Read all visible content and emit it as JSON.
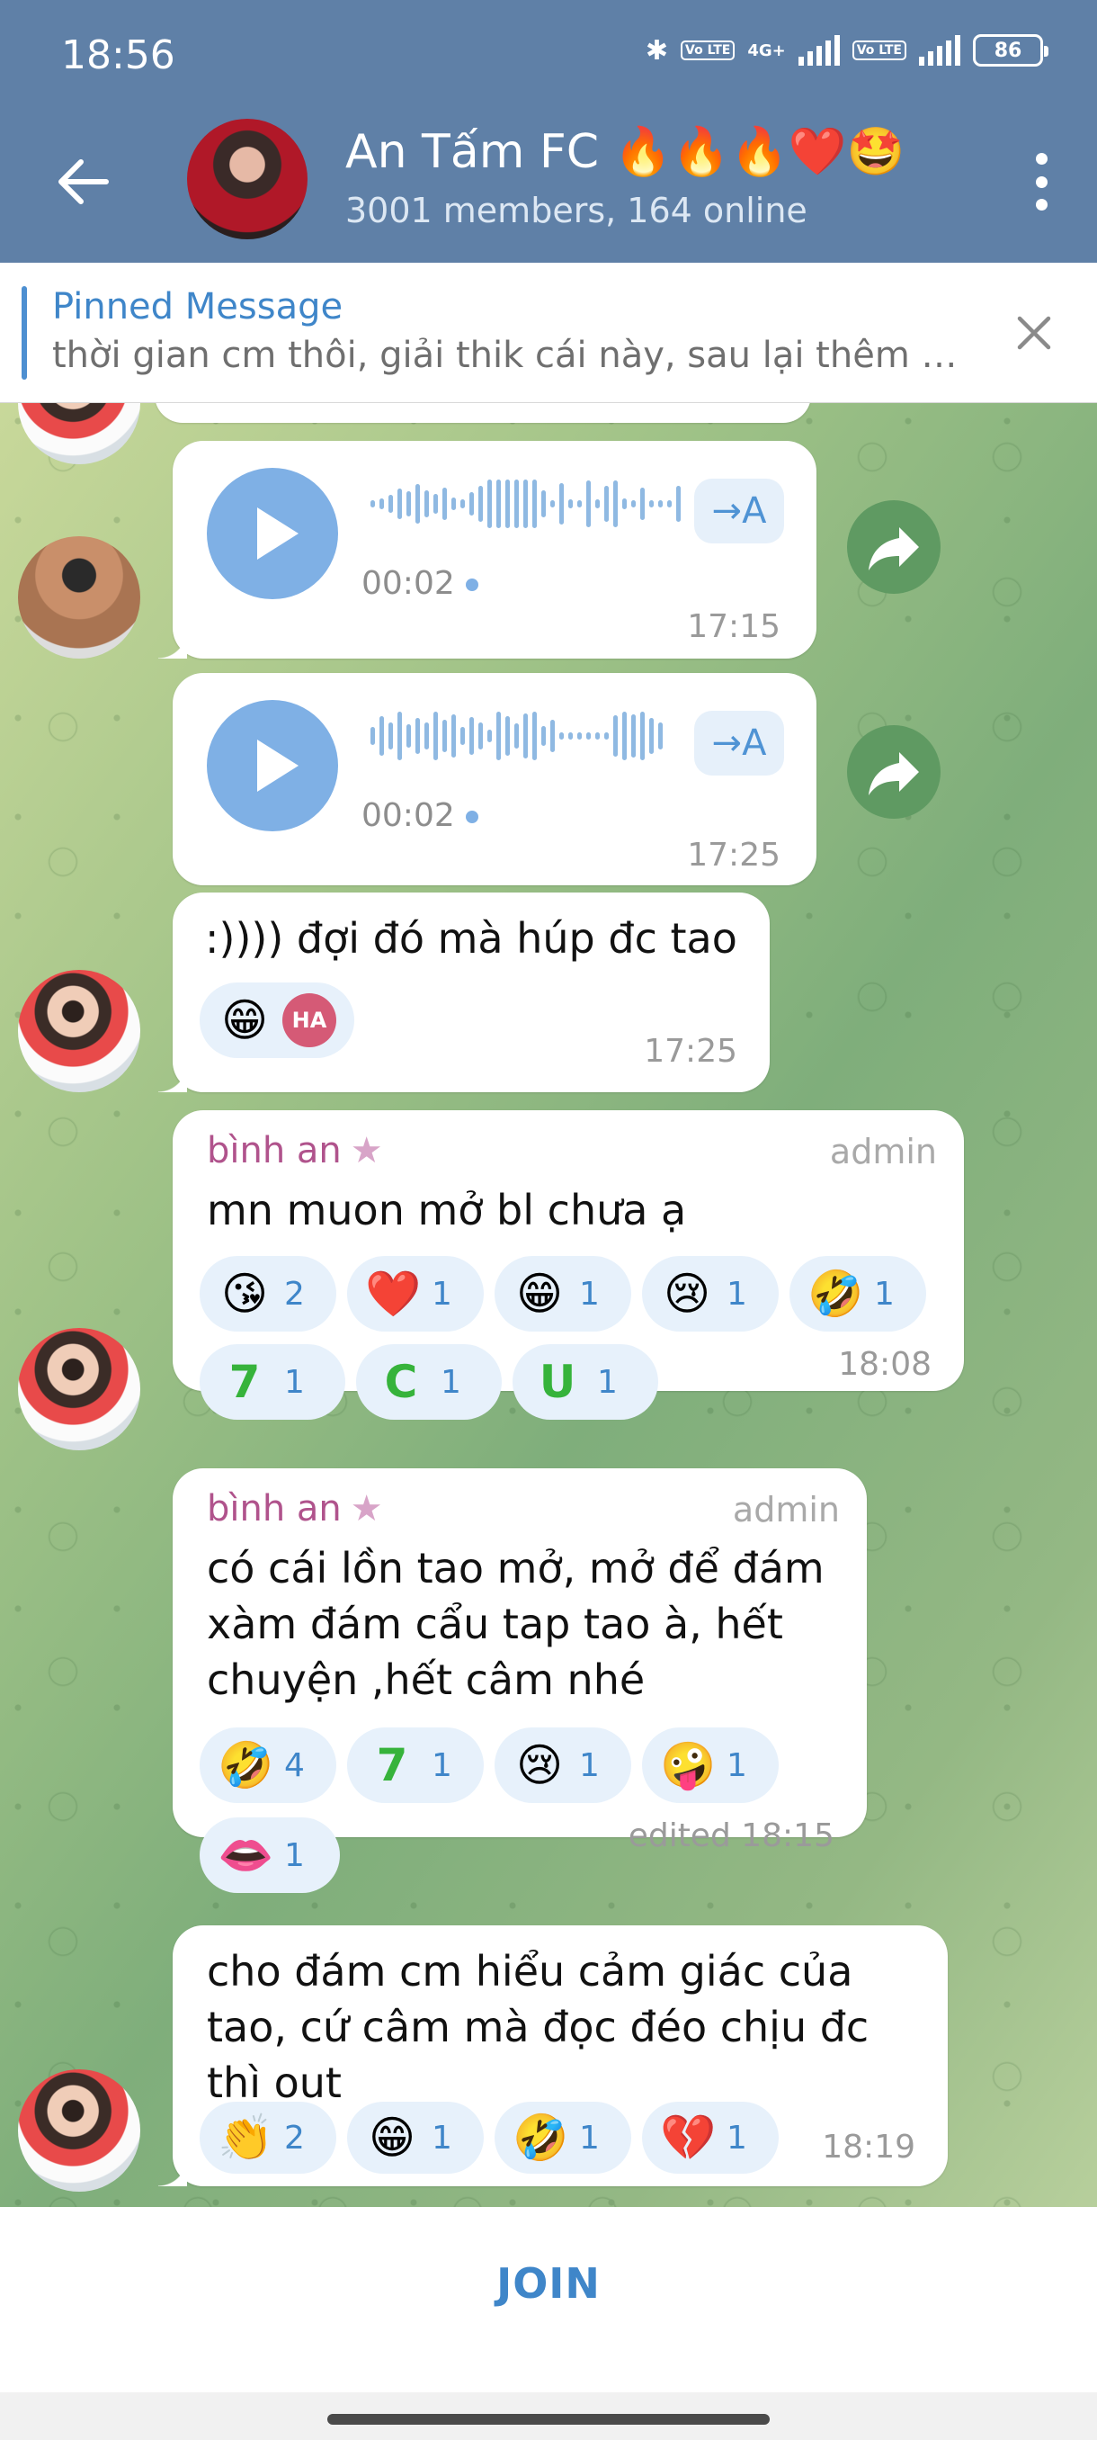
{
  "status_bar": {
    "time": "18:56",
    "battery": "86",
    "network": "4G+",
    "lte_label": "Vo LTE"
  },
  "header": {
    "title": "An Tấm FC 🔥🔥🔥❤️🤩",
    "subtitle": "3001 members, 164 online"
  },
  "pinned": {
    "title": "Pinned Message",
    "text": "thời gian cm thôi, giải thik cái này, sau lại thêm c..."
  },
  "messages": [
    {
      "type": "voice",
      "duration": "00:02",
      "time": "17:15",
      "transcribe_label": "→A"
    },
    {
      "type": "voice",
      "duration": "00:02",
      "time": "17:25",
      "transcribe_label": "→A"
    },
    {
      "type": "text",
      "text": ":)))) đợi đó mà húp đc tao",
      "time": "17:25",
      "reactions": [
        {
          "emoji": "😁",
          "user_initials": "HA"
        }
      ]
    },
    {
      "type": "text",
      "sender": "bình an",
      "sender_badge": "★",
      "role": "admin",
      "text": "mn muon mở bl chưa ạ",
      "time": "18:08",
      "reactions": [
        {
          "emoji": "😘",
          "count": "2"
        },
        {
          "emoji": "❤️",
          "count": "1"
        },
        {
          "emoji": "😁",
          "count": "1"
        },
        {
          "emoji": "😢",
          "count": "1"
        },
        {
          "emoji": "🤣",
          "count": "1"
        },
        {
          "emoji": "7",
          "count": "1"
        },
        {
          "emoji": "C",
          "count": "1"
        },
        {
          "emoji": "U",
          "count": "1"
        }
      ]
    },
    {
      "type": "text",
      "sender": "bình an",
      "sender_badge": "★",
      "role": "admin",
      "text_lines": [
        "có cái lồn tao mở, mở để đám",
        "xàm đám cẩu tap tao à,  hết",
        "chuyện ,hết câm nhé"
      ],
      "time": "edited 18:15",
      "reactions": [
        {
          "emoji": "🤣",
          "count": "4"
        },
        {
          "emoji": "7",
          "count": "1"
        },
        {
          "emoji": "😢",
          "count": "1"
        },
        {
          "emoji": "🤪",
          "count": "1"
        },
        {
          "emoji": "👄",
          "count": "1"
        }
      ]
    },
    {
      "type": "text",
      "text_lines": [
        "cho đám cm hiểu cảm giác của",
        "tao, cứ câm mà đọc đéo chịu đc",
        "thì out"
      ],
      "time": "18:19",
      "reactions": [
        {
          "emoji": "👏",
          "count": "2"
        },
        {
          "emoji": "😁",
          "count": "1"
        },
        {
          "emoji": "🤣",
          "count": "1"
        },
        {
          "emoji": "💔",
          "count": "1"
        }
      ]
    }
  ],
  "join_label": "JOIN",
  "icons": {
    "back": "arrow-left-icon",
    "menu": "more-vertical-icon",
    "close": "close-icon",
    "play": "play-icon",
    "share": "forward-icon"
  },
  "colors": {
    "header": "#5f80a7",
    "accent": "#3f86c9",
    "sender": "#b0538c",
    "reaction_bg": "#e7f1fb"
  }
}
